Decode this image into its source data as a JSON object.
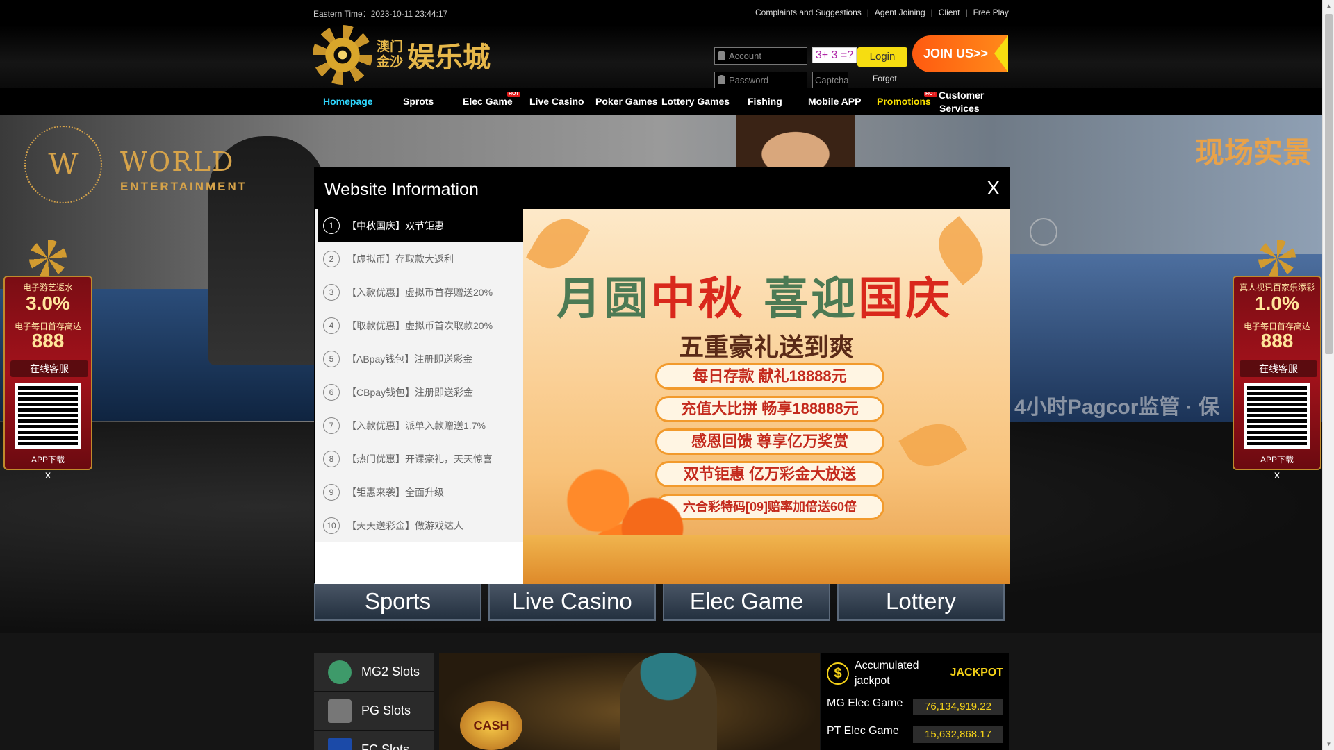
{
  "topbar": {
    "time_label": "Eastern Time：2023-10-11 23:44:17",
    "links": [
      "Complaints and Suggestions",
      "Agent Joining",
      "Client",
      "Free Play"
    ],
    "separator": "|"
  },
  "logo": {
    "small_line1": "澳门",
    "small_line2": "金沙",
    "big": "娱乐城"
  },
  "login": {
    "account_placeholder": "Account",
    "password_placeholder": "Password",
    "captcha_image_text": "3+ 3 =?",
    "captcha_placeholder": "Captcha",
    "login_label": "Login",
    "forgot_label": "Forgot",
    "join_label": "JOIN US>>"
  },
  "nav": {
    "items": [
      "Homepage",
      "Sprots",
      "Elec Game",
      "Live Casino",
      "Poker Games",
      "Lottery Games",
      "Fishing",
      "Mobile APP",
      "Promotions",
      "Customer",
      "Services"
    ],
    "hot_badge": "HOT"
  },
  "banner": {
    "brand_mark": "W",
    "brand_line1": "WORLD",
    "brand_line2": "ENTERTAINMENT",
    "live_label": "现场实景",
    "marquee": "4小时Pagcor监管 · 保"
  },
  "float_left": {
    "label1": "电子游艺返水",
    "value1": "3.0%",
    "label2": "电子每日首存高达",
    "value2": "888",
    "service": "在线客服",
    "app": "APP下载",
    "close": "X"
  },
  "float_right": {
    "label1": "真人视讯百家乐添彩",
    "value1": "1.0%",
    "label2": "电子每日首存高达",
    "value2": "888",
    "service": "在线客服",
    "app": "APP下载",
    "close": "X"
  },
  "categories": [
    "Sports",
    "Live Casino",
    "Elec Game",
    "Lottery"
  ],
  "slots": [
    "MG2 Slots",
    "PG Slots",
    "FC Slots"
  ],
  "promo_image": {
    "badge": "CASH DROP"
  },
  "jackpot": {
    "coin": "$",
    "label": "Accumulated jackpot",
    "title": "JACKPOT",
    "rows": [
      {
        "name": "MG Elec Game",
        "value": "76,134,919.22"
      },
      {
        "name": "PT Elec Game",
        "value": "15,632,868.17"
      }
    ]
  },
  "modal": {
    "title": "Website Information",
    "close": "X",
    "items": [
      {
        "num": "1",
        "text": "【中秋国庆】双节钜惠"
      },
      {
        "num": "2",
        "text": "【虚拟币】存取款大返利"
      },
      {
        "num": "3",
        "text": "【入款优惠】虚拟币首存赠送20%"
      },
      {
        "num": "4",
        "text": "【取款优惠】虚拟币首次取款20%"
      },
      {
        "num": "5",
        "text": "【ABpay钱包】注册即送彩金"
      },
      {
        "num": "6",
        "text": "【CBpay钱包】注册即送彩金"
      },
      {
        "num": "7",
        "text": "【入款优惠】派单入款赠送1.7%"
      },
      {
        "num": "8",
        "text": "【热门优惠】开课豪礼，天天惊喜"
      },
      {
        "num": "9",
        "text": "【钜惠来袭】全面升级"
      },
      {
        "num": "10",
        "text": "【天天送彩金】做游戏达人"
      }
    ],
    "poster": {
      "headline_a": "月圆",
      "headline_b": "中秋",
      "headline_c": "喜迎",
      "headline_d": "国庆",
      "subtitle": "五重豪礼送到爽",
      "rows": [
        "每日存款 献礼18888元",
        "充值大比拼 畅享188888元",
        "感恩回馈 尊享亿万奖赏",
        "双节钜惠 亿万彩金大放送",
        "六合彩特码[09]赔率加倍送60倍"
      ]
    }
  },
  "colors": {
    "accent_yellow": "#f6dd11",
    "join_orange": "#ff6a14",
    "active_nav": "#2fd7ff",
    "promo_nav": "#fce300",
    "gold": "#d6a34a"
  }
}
